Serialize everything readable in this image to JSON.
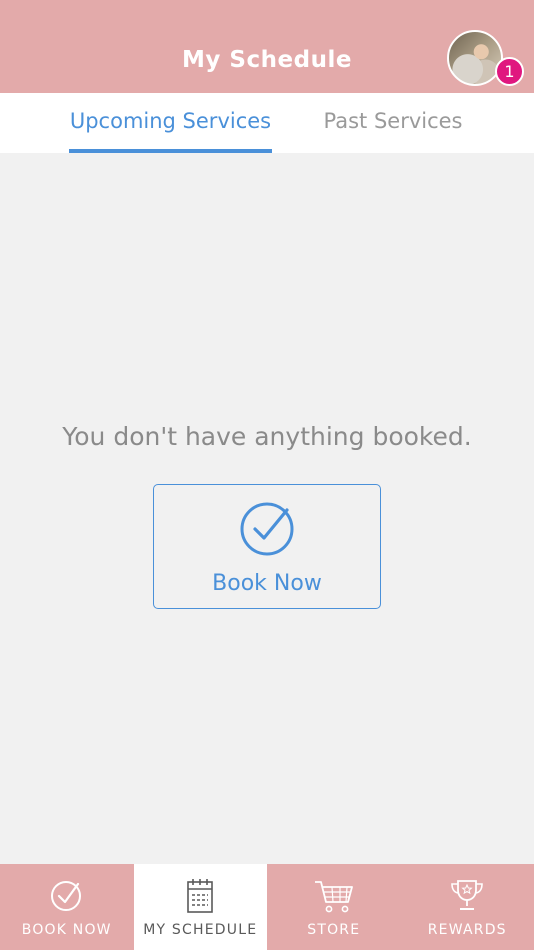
{
  "header": {
    "title": "My Schedule",
    "notification_count": "1"
  },
  "tabs": [
    {
      "label": "Upcoming Services",
      "active": true
    },
    {
      "label": "Past Services",
      "active": false
    }
  ],
  "empty_state": {
    "message": "You don't have anything booked.",
    "button_label": "Book Now",
    "icon": "check-circle-icon"
  },
  "bottom_nav": [
    {
      "label": "BOOK NOW",
      "icon": "check-circle-icon",
      "active": false
    },
    {
      "label": "MY SCHEDULE",
      "icon": "calendar-icon",
      "active": true
    },
    {
      "label": "STORE",
      "icon": "cart-icon",
      "active": false
    },
    {
      "label": "REWARDS",
      "icon": "trophy-icon",
      "active": false
    }
  ],
  "colors": {
    "brand_pink": "#e3aaaa",
    "accent_blue": "#4a90d9",
    "badge_magenta": "#e0177f",
    "background": "#f1f1f1"
  }
}
